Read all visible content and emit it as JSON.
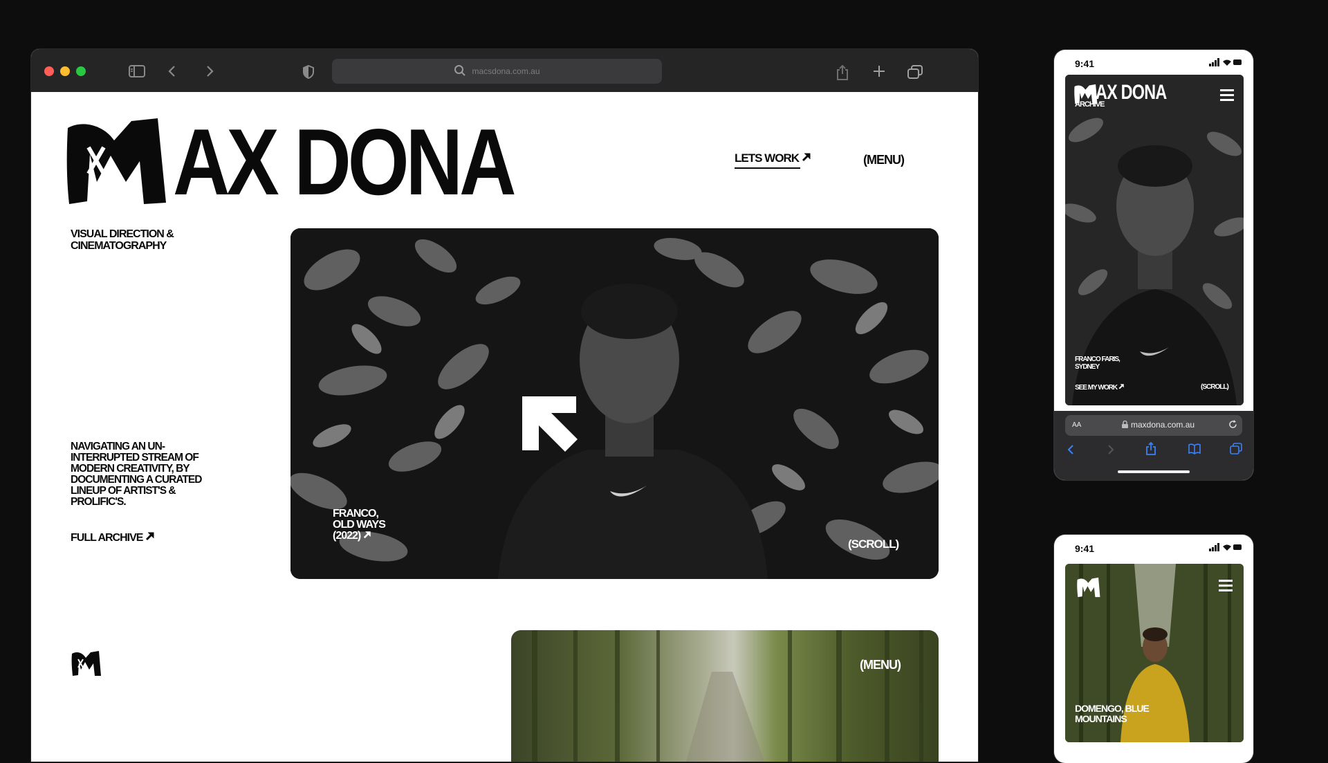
{
  "browser": {
    "url": "macsdona.com.au",
    "traffic_lights": [
      "#ff5f57",
      "#febc2e",
      "#28c840"
    ]
  },
  "site": {
    "logo_text": "AX DONA",
    "nav": {
      "letswork": "LETS WORK",
      "menu": "(MENU)"
    },
    "tagline": [
      "VISUAL DIRECTION &",
      "CINEMATOGRAPHY"
    ],
    "description": [
      "NAVIGATING AN UN-",
      "INTERRUPTED STREAM OF",
      "MODERN CREATIVITY, BY",
      "DOCUMENTING A CURATED",
      "LINEUP OF ARTIST'S &",
      "PROLIFIC'S."
    ],
    "full_archive": "FULL ARCHIVE",
    "hero": {
      "caption": [
        "FRANCO,",
        "OLD WAYS",
        "(2022)"
      ],
      "scroll": "(SCROLL)"
    },
    "forest_menu": "(MENU)"
  },
  "phone1": {
    "time": "9:41",
    "logo_text": "AX DONA",
    "sub": "ARCHIVE",
    "caption": [
      "FRANCO FARIS,",
      "SYDNEY"
    ],
    "see_work": "SEE MY WORK",
    "scroll": "(SCROLL)",
    "url": "maxdona.com.au",
    "aa": "AA"
  },
  "phone2": {
    "time": "9:41",
    "caption": [
      "DOMENGO, BLUE",
      "MOUNTAINS"
    ]
  },
  "colors": {
    "bg": "#0d0d0d",
    "page": "#ffffff",
    "ink": "#0a0a0a",
    "toolbar": "#252526",
    "safari_blue": "#3b82f6"
  }
}
